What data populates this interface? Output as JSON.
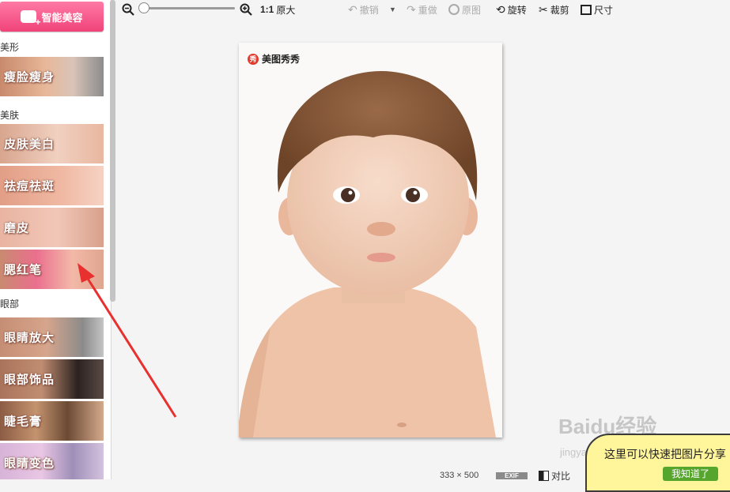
{
  "sidebar": {
    "smart_button": "智能美容",
    "sections": [
      {
        "title": "美形",
        "items": [
          "瘦脸瘦身"
        ]
      },
      {
        "title": "美肤",
        "items": [
          "皮肤美白",
          "祛痘祛斑",
          "磨皮",
          "腮红笔"
        ]
      },
      {
        "title": "眼部",
        "items": [
          "眼睛放大",
          "眼部饰品",
          "睫毛膏",
          "眼睛变色"
        ]
      }
    ]
  },
  "toolbar": {
    "zoom_1to1": "1:1",
    "original_size": "原大",
    "undo": "撤销",
    "redo": "重做",
    "original": "原图",
    "rotate": "旋转",
    "crop": "裁剪",
    "size": "尺寸"
  },
  "photo": {
    "watermark": "美图秀秀",
    "watermark_badge": "秀"
  },
  "status": {
    "width": "333",
    "times": "×",
    "height": "500",
    "exif": "EXIF",
    "compare": "对比"
  },
  "tooltip": {
    "text": "这里可以快速把图片分享",
    "ok": "我知道了"
  },
  "watermark_site": {
    "brand": "Baidu经验",
    "url": "jingyan.baidu.com"
  },
  "colors": {
    "accent_pink": "#f0437a",
    "arrow_red": "#e8302e",
    "bubble_yellow": "#fff59a",
    "ok_green": "#56a52d"
  }
}
